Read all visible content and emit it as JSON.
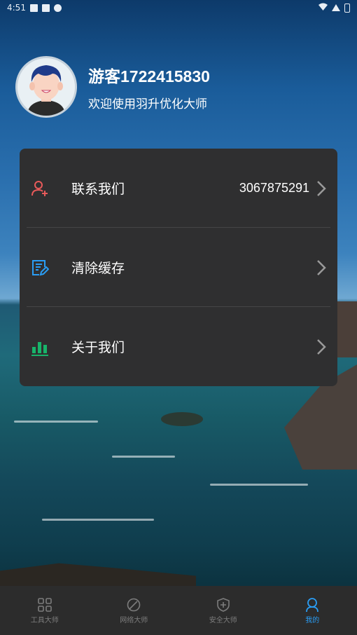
{
  "status_bar": {
    "time": "4:51"
  },
  "profile": {
    "user_name": "游客1722415830",
    "welcome": "欢迎使用羽升优化大师"
  },
  "menu": {
    "items": [
      {
        "label": "联系我们",
        "value": "3067875291",
        "icon": "contact-icon",
        "icon_color": "#e85a5a"
      },
      {
        "label": "清除缓存",
        "value": "",
        "icon": "edit-document-icon",
        "icon_color": "#2a9df4"
      },
      {
        "label": "关于我们",
        "value": "",
        "icon": "bar-chart-icon",
        "icon_color": "#18b46a"
      }
    ]
  },
  "bottom_nav": {
    "tabs": [
      {
        "label": "工具大师",
        "icon": "grid-icon",
        "active": false
      },
      {
        "label": "网络大师",
        "icon": "leaf-icon",
        "active": false
      },
      {
        "label": "安全大师",
        "icon": "shield-icon",
        "active": false
      },
      {
        "label": "我的",
        "icon": "person-icon",
        "active": true
      }
    ]
  },
  "colors": {
    "accent": "#2a9df4",
    "card": "#2f2f30",
    "nav": "#2c2c2c"
  }
}
